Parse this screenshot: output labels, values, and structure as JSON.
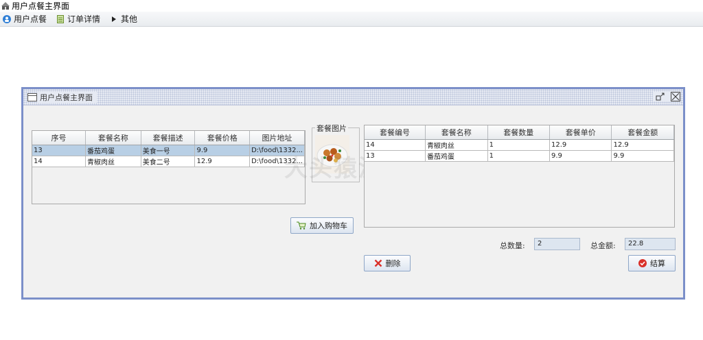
{
  "window": {
    "title": "用户点餐主界面"
  },
  "menu": [
    {
      "label": "用户点餐",
      "icon": "user-circle-icon"
    },
    {
      "label": "订单详情",
      "icon": "document-icon"
    },
    {
      "label": "其他",
      "icon": "arrow-icon"
    }
  ],
  "inner_frame": {
    "title": "用户点餐主界面"
  },
  "watermark": "大头猿源码",
  "menu_table": {
    "columns": [
      "序号",
      "套餐名称",
      "套餐描述",
      "套餐价格",
      "图片地址"
    ],
    "rows": [
      {
        "id": "13",
        "name": "番茄鸡蛋",
        "desc": "美食一号",
        "price": "9.9",
        "path": "D:\\food\\1332..."
      },
      {
        "id": "14",
        "name": "青椒肉丝",
        "desc": "美食二号",
        "price": "12.9",
        "path": "D:\\food\\1332..."
      }
    ],
    "selected_row": 0
  },
  "picture_group": {
    "legend": "套餐图片"
  },
  "cart_table": {
    "columns": [
      "套餐编号",
      "套餐名称",
      "套餐数量",
      "套餐单价",
      "套餐金额"
    ],
    "rows": [
      {
        "id": "14",
        "name": "青椒肉丝",
        "qty": "1",
        "unit": "12.9",
        "amount": "12.9"
      },
      {
        "id": "13",
        "name": "番茄鸡蛋",
        "qty": "1",
        "unit": "9.9",
        "amount": "9.9"
      }
    ]
  },
  "buttons": {
    "add_to_cart": "加入购物车",
    "delete": "删除",
    "checkout": "结算"
  },
  "totals": {
    "count_label": "总数量:",
    "count_value": "2",
    "amount_label": "总金额:",
    "amount_value": "22.8"
  },
  "colors": {
    "accent_border": "#7b8fc9",
    "selected_row": "#b8cfe5",
    "delete_red": "#d9302a"
  }
}
